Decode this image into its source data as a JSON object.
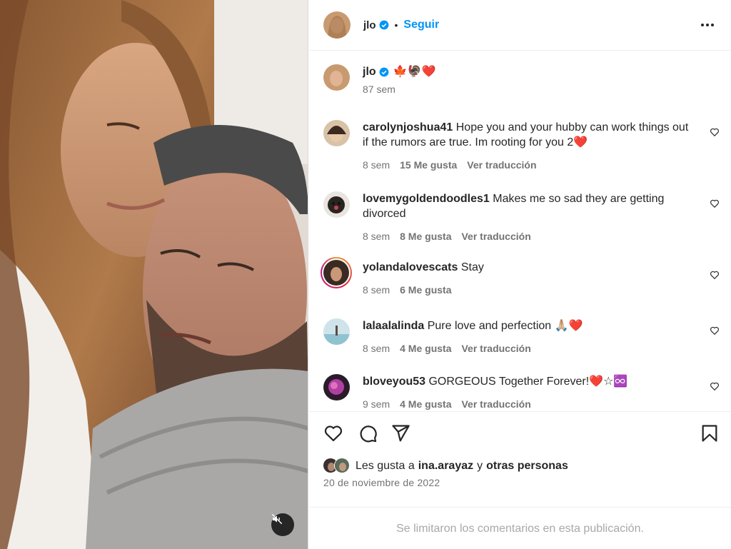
{
  "post": {
    "author": "jlo",
    "follow_label": "Seguir",
    "separator": "•",
    "caption": "🍁🦃❤️",
    "caption_age": "87 sem"
  },
  "comments": [
    {
      "user": "carolynjoshua41",
      "text": "Hope you and your hubby can work things out if the rumors are true. Im rooting for you 2❤️",
      "age": "8 sem",
      "likes": "15 Me gusta",
      "translate": "Ver traducción"
    },
    {
      "user": "lovemygoldendoodles1",
      "text": "Makes me so sad they are getting divorced",
      "age": "8 sem",
      "likes": "8 Me gusta",
      "translate": "Ver traducción"
    },
    {
      "user": "yolandalovescats",
      "text": "Stay",
      "age": "8 sem",
      "likes": "6 Me gusta",
      "translate": ""
    },
    {
      "user": "lalaalalinda",
      "text": "Pure love and perfection 🙏🏼❤️",
      "age": "8 sem",
      "likes": "4 Me gusta",
      "translate": "Ver traducción"
    },
    {
      "user": "bloveyou53",
      "text": "GORGEOUS Together Forever!❤️☆♾️",
      "age": "9 sem",
      "likes": "4 Me gusta",
      "translate": "Ver traducción"
    }
  ],
  "likes": {
    "prefix": "Les gusta a",
    "first_user": "ina.arayaz",
    "conjunction": "y",
    "others": "otras personas"
  },
  "date": "20 de noviembre de 2022",
  "comments_limited": "Se limitaron los comentarios en esta publicación.",
  "colors": {
    "accent": "#0095f6",
    "secondary_text": "#737373",
    "heart_red": "#ed4956",
    "border": "#efefef"
  }
}
